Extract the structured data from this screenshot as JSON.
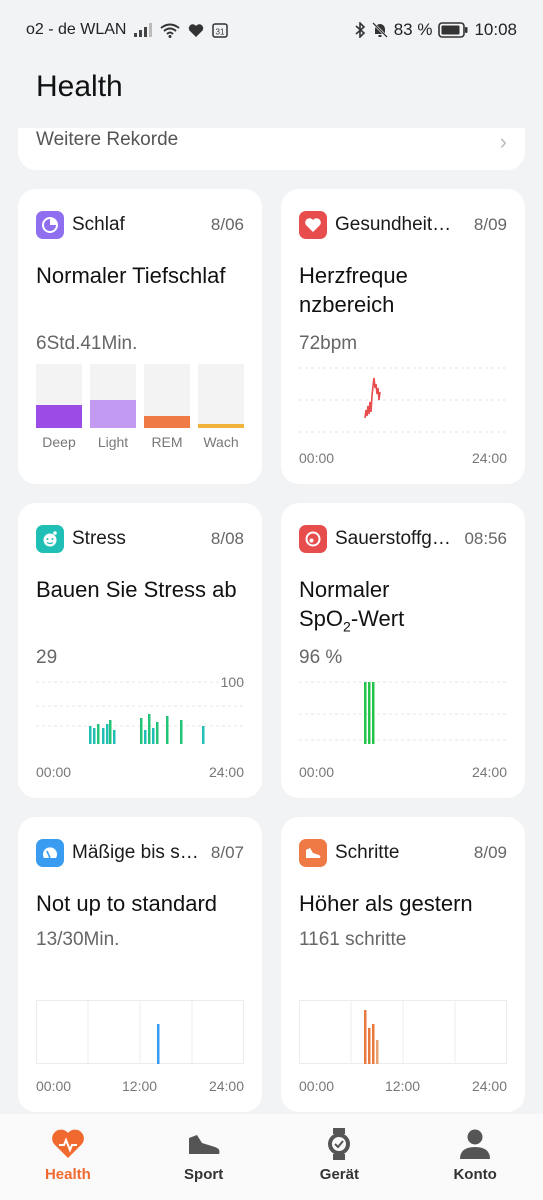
{
  "status_bar": {
    "carrier": "o2 - de WLAN",
    "calendar_day": "31",
    "battery_percent": "83 %",
    "time": "10:08"
  },
  "header": {
    "title": "Health"
  },
  "records": {
    "label": "Weitere Rekorde"
  },
  "cards": {
    "sleep": {
      "name": "Schlaf",
      "date": "8/06",
      "status": "Normaler Tiefschlaf",
      "value": "6Std.41Min.",
      "accent": "#8f6ef0",
      "stages": [
        {
          "label": "Deep",
          "level": 0.36,
          "color": "#9b4be6"
        },
        {
          "label": "Light",
          "level": 0.44,
          "color": "#c39af2"
        },
        {
          "label": "REM",
          "level": 0.18,
          "color": "#f07a45"
        },
        {
          "label": "Wach",
          "level": 0.06,
          "color": "#f2b33a"
        }
      ]
    },
    "heart": {
      "name": "Gesundheit…",
      "date": "8/09",
      "status": "Herzfrequenzbereich",
      "value": "72bpm",
      "accent": "#e84d4d",
      "axis_start": "00:00",
      "axis_end": "24:00"
    },
    "stress": {
      "name": "Stress",
      "date": "8/08",
      "status": "Bauen Sie Stress ab",
      "value": "29",
      "accent": "#1fbfb6",
      "axis_max": "100",
      "axis_start": "00:00",
      "axis_end": "24:00"
    },
    "spo2": {
      "name": "Sauerstoffg…",
      "date": "08:56",
      "status_line1": "Normaler",
      "status_line2_main": "SpO",
      "status_line2_sub": "2",
      "status_line2_end": "-Wert",
      "value": "96 %",
      "accent": "#e84d4d",
      "axis_start": "00:00",
      "axis_end": "24:00"
    },
    "activity": {
      "name": "Mäßige bis s…",
      "date": "8/07",
      "status": "Not up to standard",
      "value": "13/30Min.",
      "accent": "#3a9cf0",
      "axis_start": "00:00",
      "axis_mid": "12:00",
      "axis_end": "24:00"
    },
    "steps": {
      "name": "Schritte",
      "date": "8/09",
      "status": "Höher als gestern",
      "value": "1161 schritte",
      "accent": "#f07a45",
      "axis_start": "00:00",
      "axis_mid": "12:00",
      "axis_end": "24:00"
    }
  },
  "tabs": [
    {
      "label": "Health",
      "icon": "heart-icon",
      "active": true
    },
    {
      "label": "Sport",
      "icon": "shoe-icon",
      "active": false
    },
    {
      "label": "Gerät",
      "icon": "watch-icon",
      "active": false
    },
    {
      "label": "Konto",
      "icon": "person-icon",
      "active": false
    }
  ]
}
